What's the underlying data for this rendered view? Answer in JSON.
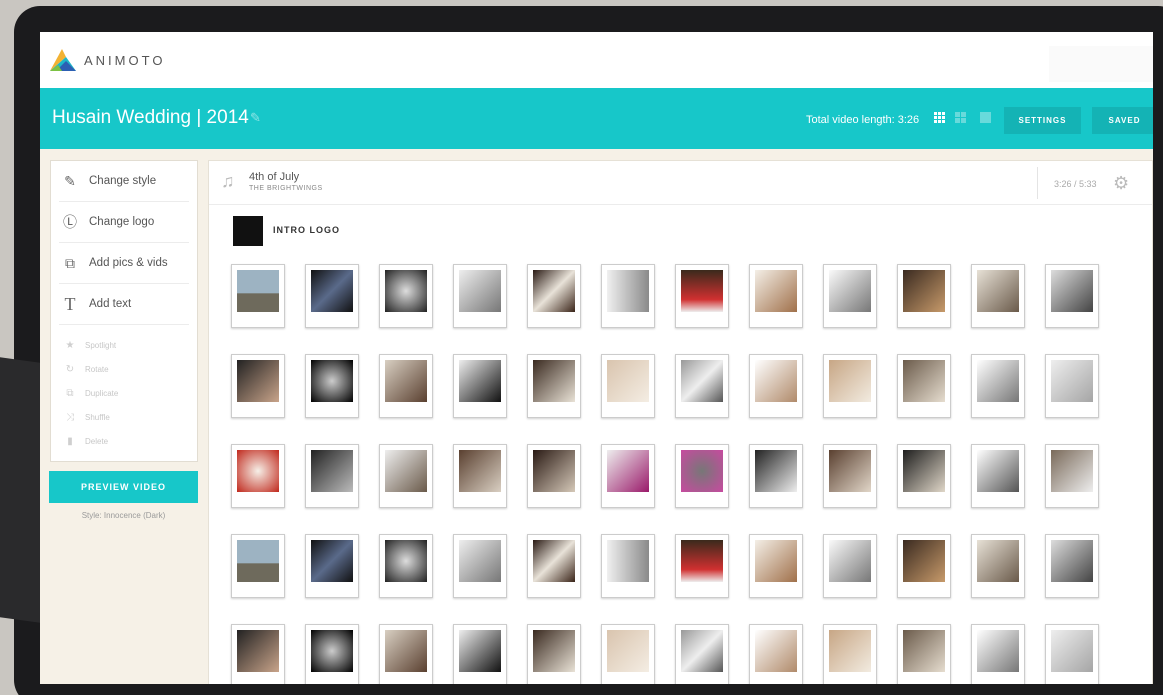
{
  "brand": {
    "name": "ANIMOTO"
  },
  "header": {
    "project_title": "Husain Wedding | 2014",
    "video_length": "Total video length: 3:26",
    "settings_label": "SETTINGS",
    "saved_label": "SAVED"
  },
  "sidebar": {
    "items": [
      {
        "label": "Change style",
        "icon": "brush-icon"
      },
      {
        "label": "Change logo",
        "icon": "logo-icon"
      },
      {
        "label": "Add pics & vids",
        "icon": "add-media-icon"
      },
      {
        "label": "Add text",
        "icon": "text-icon"
      }
    ],
    "sub_items": [
      {
        "label": "Spotlight",
        "icon": "star-icon"
      },
      {
        "label": "Rotate",
        "icon": "rotate-icon"
      },
      {
        "label": "Duplicate",
        "icon": "duplicate-icon"
      },
      {
        "label": "Shuffle",
        "icon": "shuffle-icon"
      },
      {
        "label": "Delete",
        "icon": "trash-icon"
      }
    ],
    "preview_label": "PREVIEW VIDEO",
    "style_note": "Style: Innocence (Dark)"
  },
  "music": {
    "title": "4th of July",
    "artist": "THE BRIGHTWINGS",
    "time": "3:26 / 5:33"
  },
  "intro_logo_label": "INTRO LOGO",
  "colors": {
    "accent": "#17c7c9",
    "background": "#f6f1e7"
  }
}
